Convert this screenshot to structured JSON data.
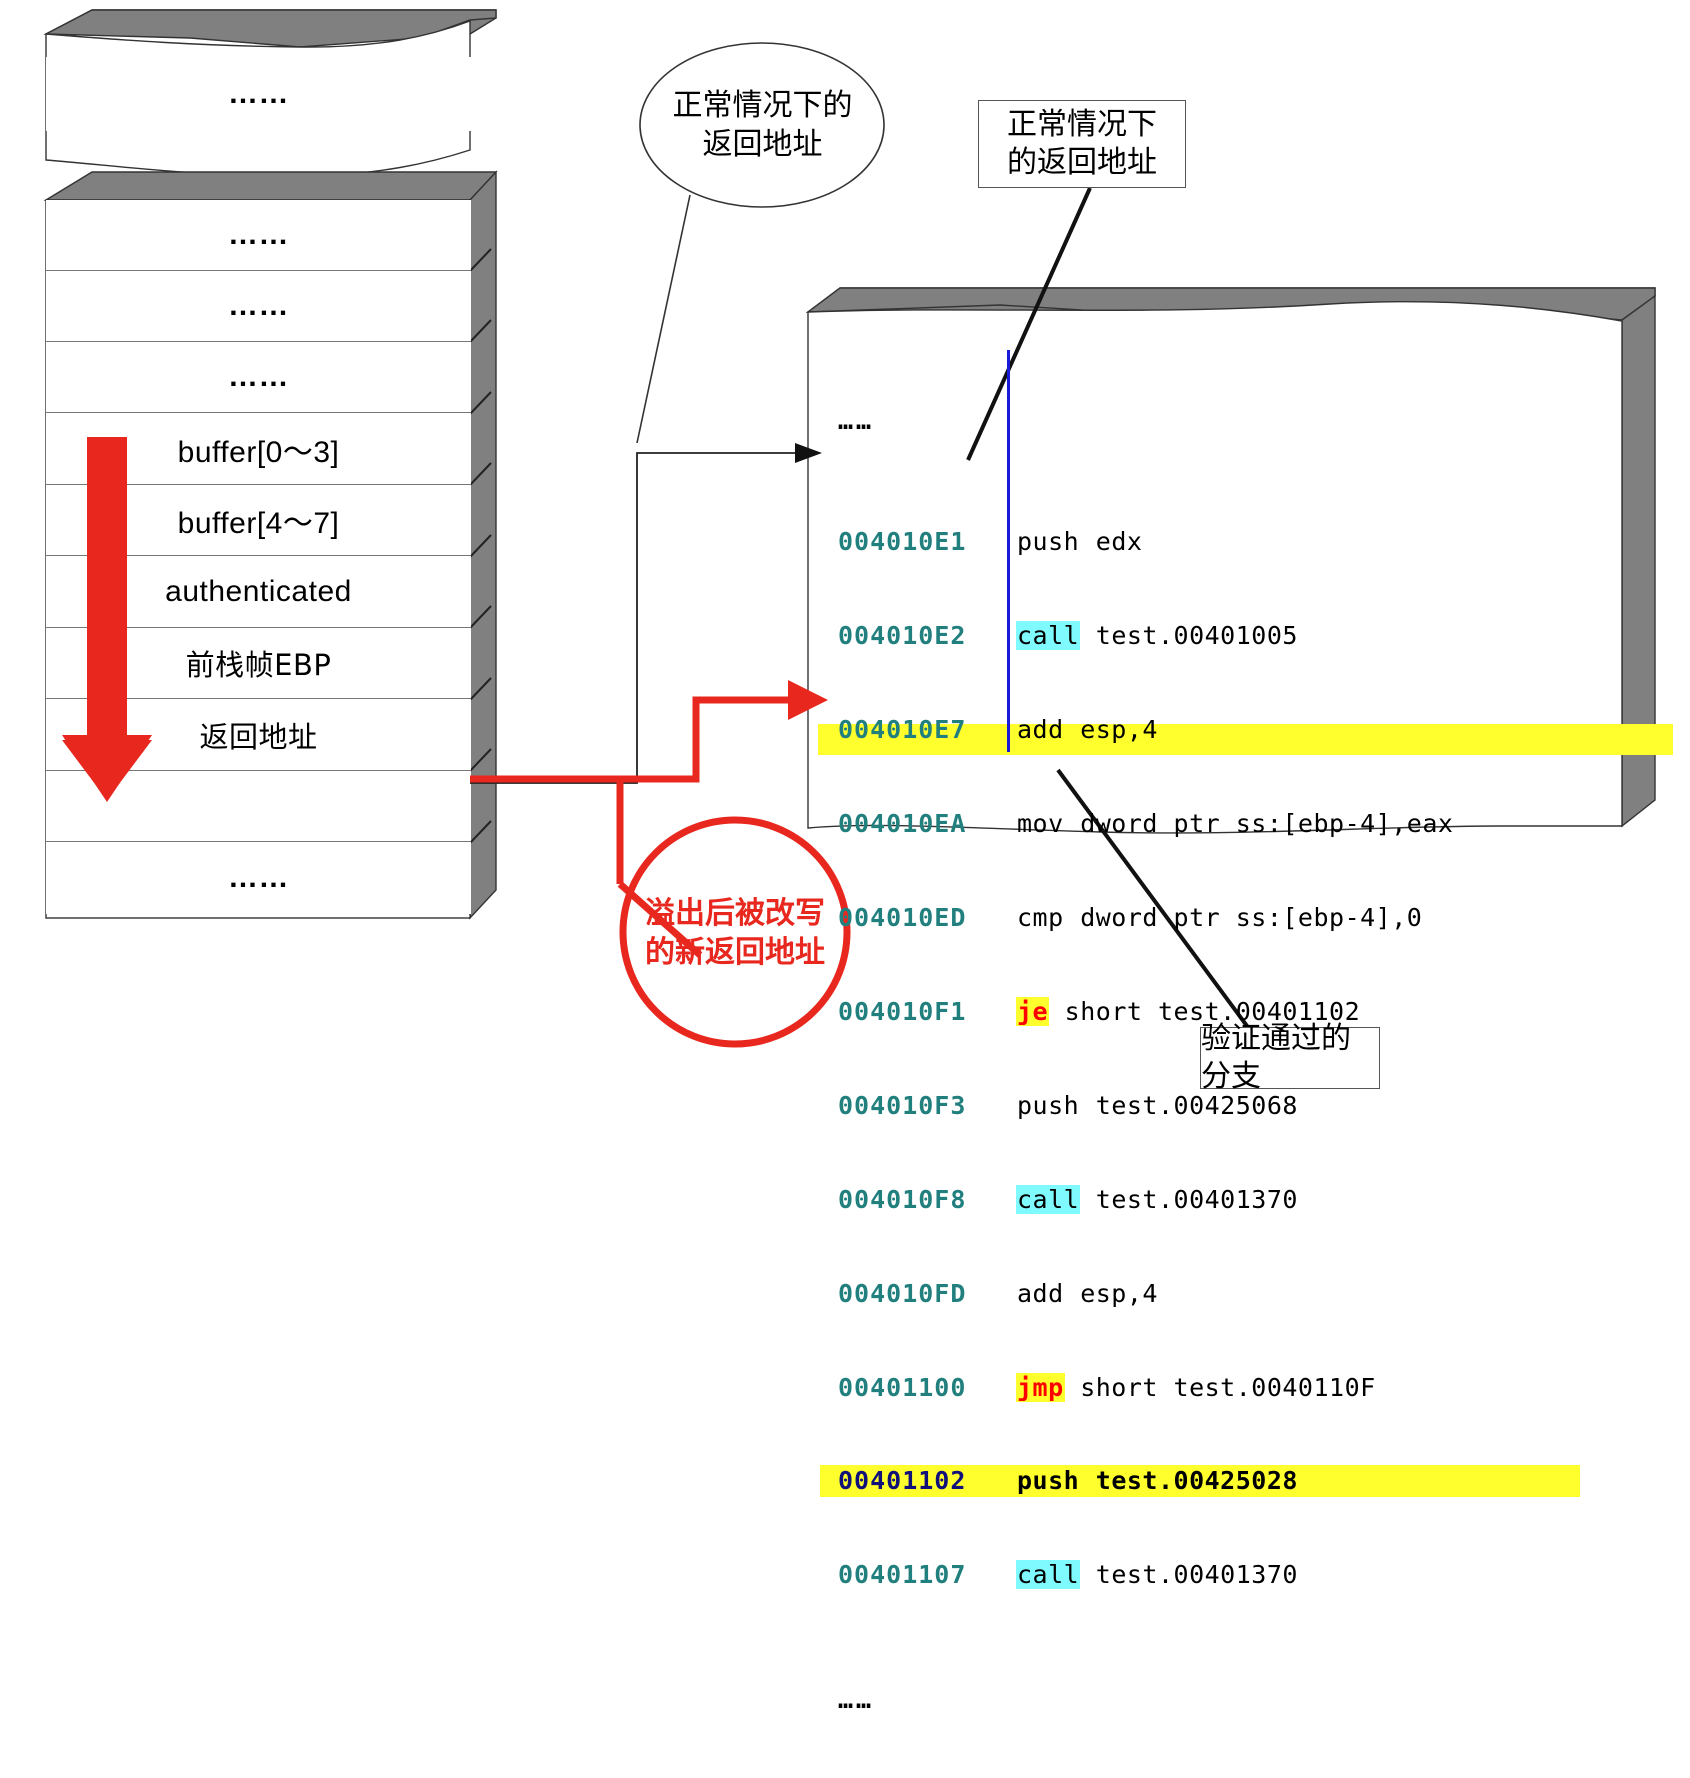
{
  "stack": {
    "top_block": {
      "rows": [
        {
          "text": "……"
        }
      ]
    },
    "main_block": {
      "rows": [
        {
          "text": "……",
          "cn": false
        },
        {
          "text": "……",
          "cn": false
        },
        {
          "text": "……",
          "cn": false
        },
        {
          "text": "buffer[0～3]",
          "cn": false
        },
        {
          "text": "buffer[4～7]",
          "cn": false
        },
        {
          "text": "authenticated",
          "cn": false
        },
        {
          "text": "前栈帧EBP",
          "cn": true
        },
        {
          "text": "返回地址",
          "cn": true
        },
        {
          "text": "",
          "cn": false
        },
        {
          "text": "……",
          "cn": false
        }
      ]
    },
    "growth_arrow": "down-arrow-red"
  },
  "code_panel": {
    "leading_ellipsis": "……",
    "trailing_ellipsis": "……",
    "lines": [
      {
        "addr": "004010E1",
        "mnemonic": "push",
        "operand": " edx",
        "mn_style": "plain",
        "row": "plain"
      },
      {
        "addr": "004010E2",
        "mnemonic": "call",
        "operand": " test.00401005",
        "mn_style": "cyan",
        "row": "plain"
      },
      {
        "addr": "004010E7",
        "mnemonic": "add",
        "operand": " esp,4",
        "mn_style": "plain",
        "row": "plain"
      },
      {
        "addr": "004010EA",
        "mnemonic": "mov",
        "operand": " dword ptr ss:[ebp-4],eax",
        "mn_style": "plain",
        "row": "plain"
      },
      {
        "addr": "004010ED",
        "mnemonic": "cmp",
        "operand": " dword ptr ss:[ebp-4],0",
        "mn_style": "plain",
        "row": "plain"
      },
      {
        "addr": "004010F1",
        "mnemonic": "je",
        "operand": " short test.00401102",
        "mn_style": "jmp",
        "row": "plain"
      },
      {
        "addr": "004010F3",
        "mnemonic": "push",
        "operand": " test.00425068",
        "mn_style": "plain",
        "row": "plain"
      },
      {
        "addr": "004010F8",
        "mnemonic": "call",
        "operand": " test.00401370",
        "mn_style": "cyan",
        "row": "plain"
      },
      {
        "addr": "004010FD",
        "mnemonic": "add",
        "operand": " esp,4",
        "mn_style": "plain",
        "row": "plain"
      },
      {
        "addr": "00401100",
        "mnemonic": "jmp",
        "operand": " short test.0040110F",
        "mn_style": "jmp",
        "row": "plain"
      },
      {
        "addr": "00401102",
        "mnemonic": "push",
        "operand": " test.00425028",
        "mn_style": "plain",
        "row": "highlight"
      },
      {
        "addr": "00401107",
        "mnemonic": "call",
        "operand": " test.00401370",
        "mn_style": "cyan",
        "row": "plain"
      }
    ]
  },
  "annotations": {
    "ellipse_callout": {
      "line1": "正常情况下的",
      "line2": "返回地址"
    },
    "normal_return_box": {
      "line1": "正常情况下",
      "line2": "的返回地址"
    },
    "overflow_callout": {
      "line1": "溢出后被改写",
      "line2": "的新返回地址"
    },
    "branch_box": {
      "line1": "验证通过的分支"
    }
  },
  "colors": {
    "address_teal": "#21807e",
    "address_navy": "#10107a",
    "highlight_yellow": "#ffff2e",
    "call_cyan": "#7ffbff",
    "jump_red": "#ff0000",
    "accent_red": "#e8281e",
    "block_face_grey": "#808080"
  }
}
